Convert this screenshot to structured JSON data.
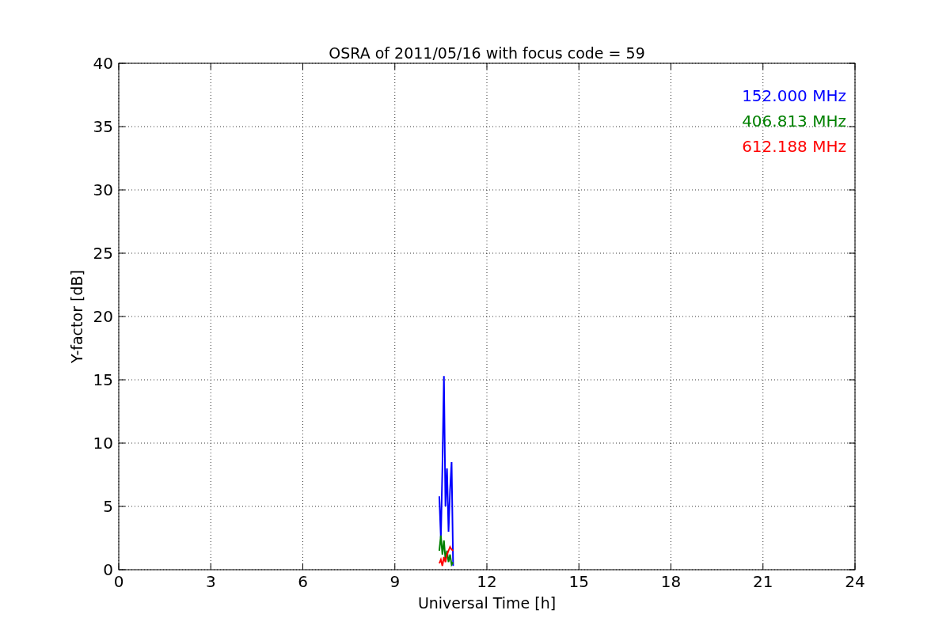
{
  "figure": {
    "chart_data": {
      "type": "line",
      "title": "OSRA of 2011/05/16 with focus code = 59",
      "xlabel": "Universal Time [h]",
      "ylabel": "Y-factor [dB]",
      "x": [
        10.45,
        10.5,
        10.55,
        10.6,
        10.65,
        10.7,
        10.75,
        10.8,
        10.85,
        10.9
      ],
      "series": [
        {
          "name": "152.000 MHz",
          "color": "#0000ff",
          "values": [
            5.8,
            2.5,
            8,
            15.3,
            5,
            8,
            3,
            6.3,
            8.5,
            0.3
          ]
        },
        {
          "name": "406.813 MHz",
          "color": "#008000",
          "values": [
            1.5,
            2.7,
            1.2,
            2.3,
            0.8,
            1.5,
            0.6,
            1.2,
            0.4,
            0.6
          ]
        },
        {
          "name": "612.188 MHz",
          "color": "#ff0000",
          "values": [
            0.5,
            0.8,
            0.3,
            1,
            0.6,
            1.2,
            1.5,
            1.8,
            1.6,
            1.5
          ]
        }
      ],
      "xlim": [
        0,
        24
      ],
      "ylim": [
        0,
        40
      ],
      "xticks": [
        0,
        3,
        6,
        9,
        12,
        15,
        18,
        21,
        24
      ],
      "yticks": [
        0,
        5,
        10,
        15,
        20,
        25,
        30,
        35,
        40
      ],
      "grid": true
    }
  }
}
